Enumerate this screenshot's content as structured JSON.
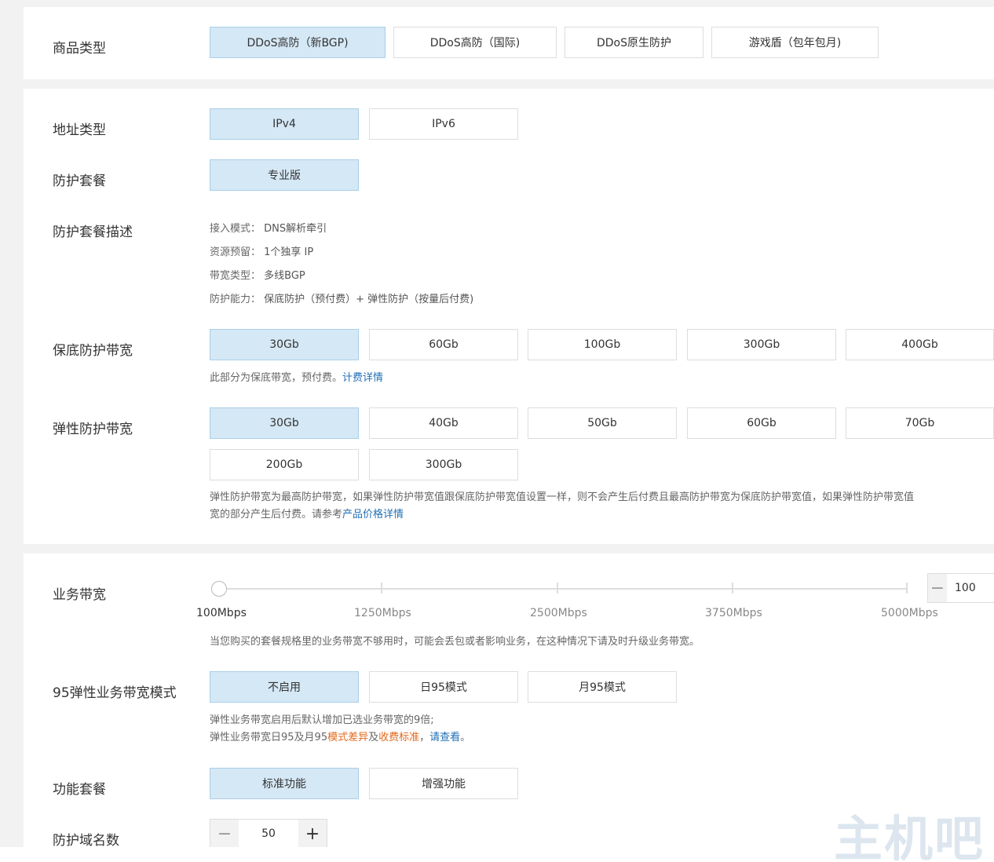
{
  "product_type": {
    "label": "商品类型",
    "options": [
      "DDoS高防（新BGP)",
      "DDoS高防（国际)",
      "DDoS原生防护",
      "游戏盾（包年包月)"
    ]
  },
  "address_type": {
    "label": "地址类型",
    "options": [
      "IPv4",
      "IPv6"
    ]
  },
  "protection_package": {
    "label": "防护套餐",
    "options": [
      "专业版"
    ]
  },
  "package_desc": {
    "label": "防护套餐描述",
    "rows": [
      {
        "key": "接入模式：",
        "value": "DNS解析牵引"
      },
      {
        "key": "资源预留：",
        "value": "1个独享 IP"
      },
      {
        "key": "带宽类型：",
        "value": "多线BGP"
      },
      {
        "key": "防护能力：",
        "value": "保底防护（预付费）+ 弹性防护（按量后付费)"
      }
    ]
  },
  "base_bandwidth": {
    "label": "保底防护带宽",
    "options": [
      "30Gb",
      "60Gb",
      "100Gb",
      "300Gb",
      "400Gb"
    ],
    "note": "此部分为保底带宽，预付费。",
    "note_link": "计费详情"
  },
  "elastic_bandwidth": {
    "label": "弹性防护带宽",
    "options": [
      "30Gb",
      "40Gb",
      "50Gb",
      "60Gb",
      "70Gb",
      "200Gb",
      "300Gb"
    ],
    "note_line1": "弹性防护带宽为最高防护带宽，如果弹性防护带宽值跟保底防护带宽值设置一样，则不会产生后付费且最高防护带宽为保底防护带宽值，如果弹性防护带宽值",
    "note_line2": "宽的部分产生后付费。请参考",
    "note_link": "产品价格详情"
  },
  "business_bandwidth": {
    "label": "业务带宽",
    "ticks": [
      "100Mbps",
      "1250Mbps",
      "2500Mbps",
      "3750Mbps",
      "5000Mbps"
    ],
    "value": "100",
    "minus": "−",
    "note": "当您购买的套餐规格里的业务带宽不够用时，可能会丢包或者影响业务，在这种情况下请及时升级业务带宽。"
  },
  "elastic_mode": {
    "label": "95弹性业务带宽模式",
    "options": [
      "不启用",
      "日95模式",
      "月95模式"
    ],
    "note_line1": "弹性业务带宽启用后默认增加已选业务带宽的9倍;",
    "note_line2_a": "弹性业务带宽日95及月95",
    "note_link1": "模式差异",
    "note_mid": "及",
    "note_link2": "收费标准",
    "note_sep": "，",
    "note_link3": "请查看",
    "note_end": "。"
  },
  "feature_package": {
    "label": "功能套餐",
    "options": [
      "标准功能",
      "增强功能"
    ]
  },
  "domain_count": {
    "label": "防护域名数",
    "value": "50",
    "minus": "−",
    "plus": "+"
  },
  "watermark": "主机吧"
}
